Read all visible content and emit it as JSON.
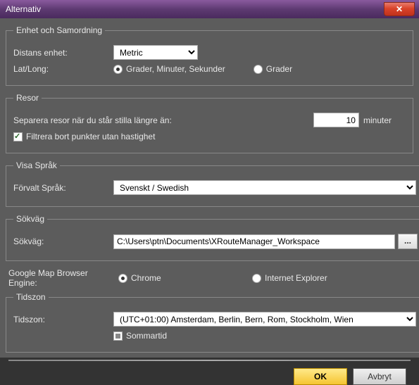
{
  "window": {
    "title": "Alternativ"
  },
  "unit_section": {
    "legend": "Enhet och Samordning",
    "distance_label": "Distans enhet:",
    "distance_value": "Metric",
    "latlong_label": "Lat/Long:",
    "radio_dms": "Грader, Minuter, Sekunder",
    "radio_dms_fixed": "Grader, Minuter, Sekunder",
    "radio_deg": "Grader"
  },
  "trips_section": {
    "legend": "Resor",
    "separate_label": "Separera resor när du står stilla längre än:",
    "separate_value": "10",
    "separate_unit": "minuter",
    "filter_label": "Filtrera bort punkter utan hastighet"
  },
  "lang_section": {
    "legend": "Visa Språk",
    "label": "Förvalt Språk:",
    "value": "Svenskt / Swedish"
  },
  "path_section": {
    "legend": "Sökväg",
    "label": "Sökväg:",
    "value": "C:\\Users\\ptn\\Documents\\XRouteManager_Workspace",
    "browse": "..."
  },
  "browser_engine": {
    "label": "Google Map Browser Engine:",
    "chrome": "Chrome",
    "ie": "Internet Explorer"
  },
  "tz_section": {
    "legend": "Tidszon",
    "label": "Tidszon:",
    "value": "(UTC+01:00) Amsterdam, Berlin, Bern, Rom, Stockholm, Wien",
    "dst": "Sommartid"
  },
  "buttons": {
    "ok": "OK",
    "cancel": "Avbryt"
  }
}
